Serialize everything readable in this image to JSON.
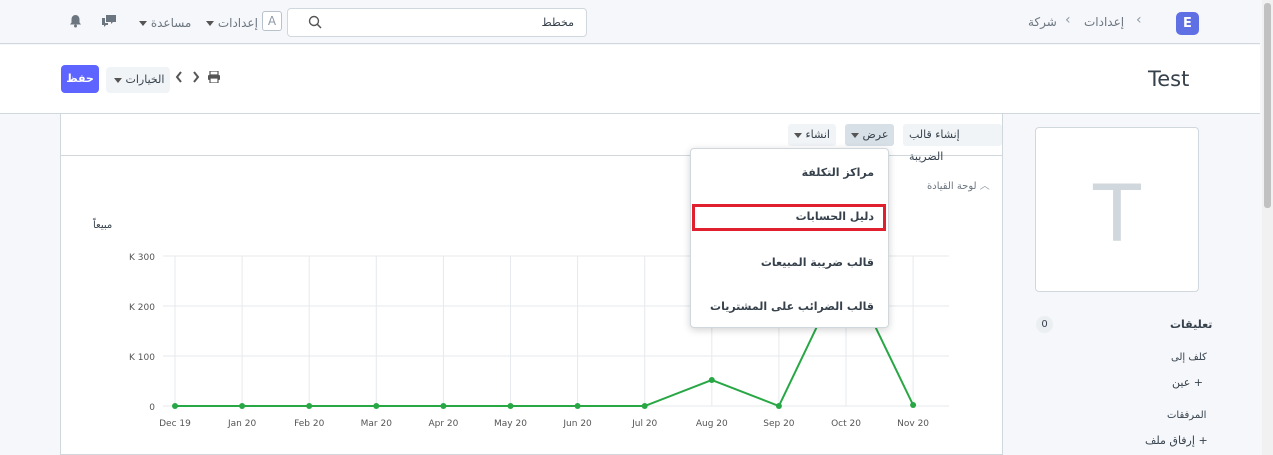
{
  "navbar": {
    "logo": "E",
    "breadcrumbs": [
      "إعدادات",
      "شركة"
    ],
    "search_value": "مخطط",
    "avatar_letter": "A",
    "settings_label": "إعدادات",
    "help_label": "مساعدة"
  },
  "page": {
    "title": "Test",
    "save_label": "حفظ",
    "options_label": "الخيارات"
  },
  "toolbar": {
    "create_tax_template": "إنشاء قالب الضريبة",
    "view_label": "عرض",
    "create_label": "انشاء"
  },
  "dashboard_label": "لوحة القيادة",
  "dropdown": {
    "items": [
      "مراكز التكلفة",
      "دليل الحسابات",
      "قالب ضريبة المبيعات",
      "قالب الضرائب على المشتريات"
    ]
  },
  "sidebar": {
    "image_letter": "T",
    "comments_label": "تعليقات",
    "comments_count": "0",
    "assigned_to_label": "كلف إلى",
    "assign_label": "عين",
    "attachments_label": "المرفقات",
    "attach_file_label": "إرفاق ملف"
  },
  "chart_data": {
    "type": "line",
    "ylabel": "مبيعاً",
    "categories": [
      "Dec 19",
      "Jan 20",
      "Feb 20",
      "Mar 20",
      "Apr 20",
      "May 20",
      "Jun 20",
      "Jul 20",
      "Aug 20",
      "Sep 20",
      "Oct 20",
      "Nov 20"
    ],
    "yticks": [
      "0",
      "K 100",
      "K 200",
      "K 300"
    ],
    "ylim": [
      0,
      300
    ],
    "series": [
      {
        "values": [
          0,
          0,
          0,
          0,
          0,
          0,
          0,
          0,
          52,
          0,
          280,
          2
        ],
        "color": "#28a745"
      }
    ]
  }
}
